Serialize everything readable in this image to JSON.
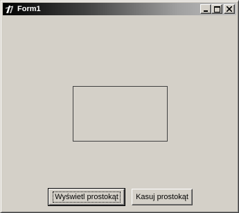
{
  "window": {
    "title": "Form1",
    "icon": "delphi-app-icon"
  },
  "caption_buttons": {
    "minimize_icon": "minimize-icon",
    "maximize_icon": "maximize-icon",
    "close_icon": "close-icon"
  },
  "buttons": {
    "show_label": "Wyświetl prostokąt",
    "clear_label": "Kasuj prostokąt"
  },
  "colors": {
    "face": "#d4d0c8",
    "title_start": "#000000",
    "title_end": "#c0c0c0",
    "rectangle_stroke": "#404040"
  }
}
